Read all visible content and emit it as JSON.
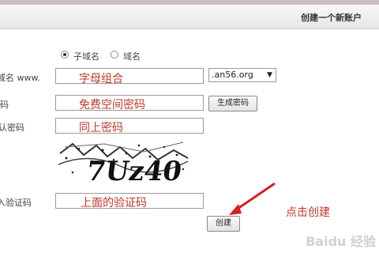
{
  "header": {
    "title": "创建一个新账户"
  },
  "form": {
    "domain_type": {
      "options": [
        {
          "label": "子域名",
          "checked": true
        },
        {
          "label": "域名",
          "checked": false
        }
      ]
    },
    "subdomain_label": "域名 www.",
    "subdomain_annotation": "字母组合",
    "domain_suffix": ".an56.org",
    "password_label": "码",
    "password_annotation": "免费空间密码",
    "generate_password_button": "生成密码",
    "confirm_label": "认密码",
    "confirm_annotation": "同上密码",
    "captcha_text": "7Uz40",
    "captcha_label": "入验证码",
    "captcha_annotation": "上面的验证码",
    "create_button": "创建",
    "click_annotation": "点击创建"
  },
  "watermark": "Baidu 经验"
}
